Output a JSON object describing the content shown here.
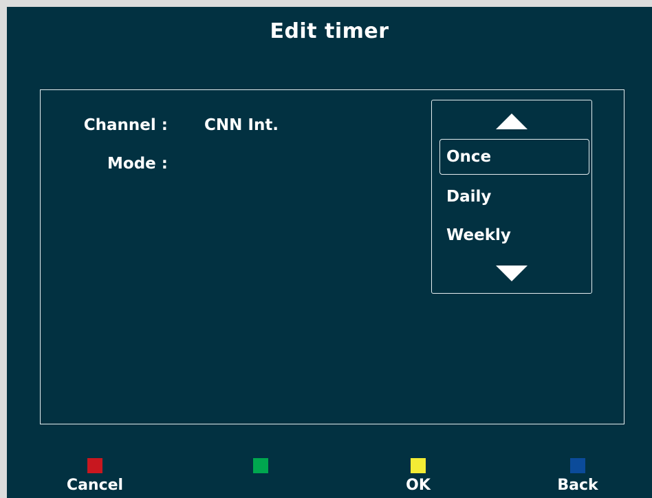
{
  "screen": {
    "title": "Edit timer"
  },
  "form": {
    "channel_label": "Channel :",
    "channel_value": "CNN Int.",
    "mode_label": "Mode :"
  },
  "mode_list": {
    "selected": "Once",
    "options": [
      "Once",
      "Daily",
      "Weekly"
    ],
    "up_icon": "triangle-up-icon",
    "down_icon": "triangle-down-icon"
  },
  "softkeys": [
    {
      "color": "#c8171f",
      "label": "Cancel"
    },
    {
      "color": "#00a74f",
      "label": ""
    },
    {
      "color": "#f3ec35",
      "label": "OK"
    },
    {
      "color": "#0b4b9a",
      "label": "Back"
    }
  ],
  "colors": {
    "background": "#023141",
    "text": "#ffffff",
    "frame": "#e6eef0"
  }
}
